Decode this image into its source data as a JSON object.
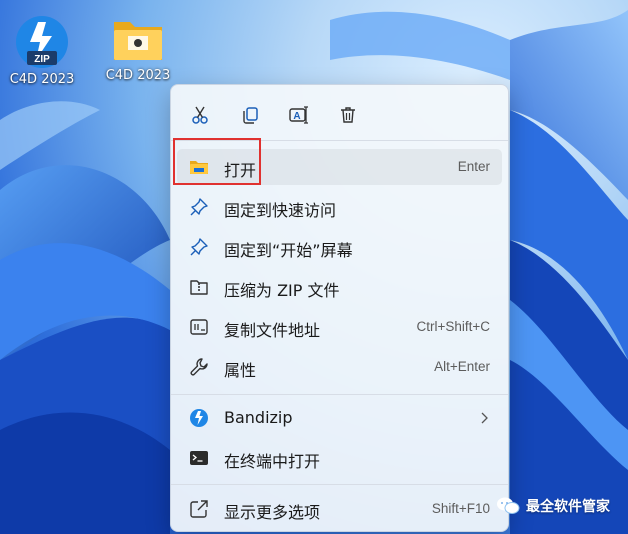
{
  "desktop": {
    "icons": [
      {
        "label": "C4D 2023",
        "icon": "bandizip-zip-icon"
      },
      {
        "label": "C4D 2023",
        "icon": "folder-icon"
      }
    ]
  },
  "context_menu": {
    "quick_actions": [
      {
        "name": "cut",
        "icon": "scissors-icon"
      },
      {
        "name": "copy",
        "icon": "copy-icon"
      },
      {
        "name": "rename",
        "icon": "rename-icon"
      },
      {
        "name": "delete",
        "icon": "trash-icon"
      }
    ],
    "items": [
      {
        "label": "打开",
        "shortcut": "Enter",
        "icon": "folder-icon"
      },
      {
        "label": "固定到快速访问",
        "shortcut": "",
        "icon": "pin-icon"
      },
      {
        "label": "固定到“开始”屏幕",
        "shortcut": "",
        "icon": "pin-icon"
      },
      {
        "label": "压缩为 ZIP 文件",
        "shortcut": "",
        "icon": "zip-icon"
      },
      {
        "label": "复制文件地址",
        "shortcut": "Ctrl+Shift+C",
        "icon": "path-icon"
      },
      {
        "label": "属性",
        "shortcut": "Alt+Enter",
        "icon": "wrench-icon"
      },
      {
        "label": "Bandizip",
        "shortcut": "",
        "icon": "bandizip-icon"
      },
      {
        "label": "在终端中打开",
        "shortcut": "",
        "icon": "terminal-icon"
      },
      {
        "label": "显示更多选项",
        "shortcut": "Shift+F10",
        "icon": "share-icon"
      }
    ]
  },
  "watermark": {
    "text": "最全软件管家"
  },
  "colors": {
    "accent": "#1a6fd6",
    "highlight": "#e0312f"
  }
}
